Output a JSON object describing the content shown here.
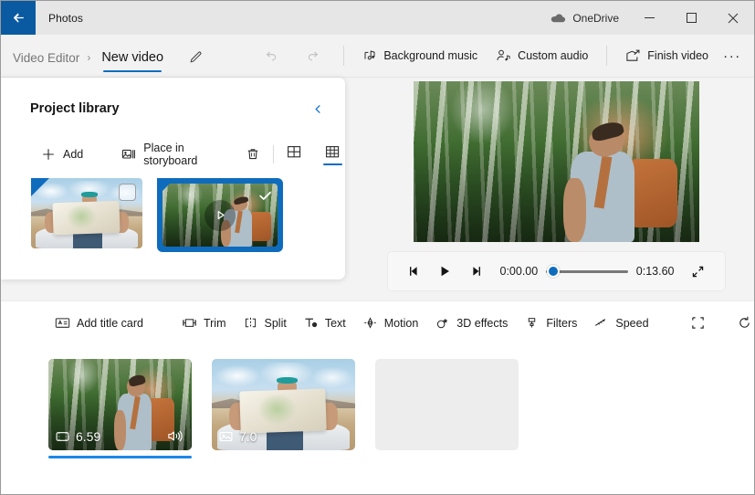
{
  "window": {
    "app_title": "Photos",
    "back_icon": "back-arrow-icon",
    "onedrive_label": "OneDrive",
    "onedrive_icon": "cloud-icon",
    "minimize_icon": "minimize-icon",
    "maximize_icon": "maximize-icon",
    "close_icon": "close-icon"
  },
  "commandbar": {
    "breadcrumb_parent": "Video Editor",
    "breadcrumb_separator": "›",
    "breadcrumb_current": "New video",
    "rename_icon": "pencil-icon",
    "undo_icon": "undo-icon",
    "redo_icon": "redo-icon",
    "items": [
      {
        "label": "Background music",
        "icon": "music-note-icon"
      },
      {
        "label": "Custom audio",
        "icon": "person-audio-icon"
      },
      {
        "label": "Finish video",
        "icon": "export-icon"
      }
    ],
    "overflow_label": "···"
  },
  "library": {
    "title": "Project library",
    "collapse_icon": "chevron-left-icon",
    "toolbar": {
      "add_label": "Add",
      "add_icon": "plus-icon",
      "place_label": "Place in storyboard",
      "place_icon": "place-in-storyboard-icon",
      "delete_icon": "trash-icon",
      "view_large_icon": "grid-large-icon",
      "view_small_icon": "grid-small-icon",
      "active_view": "grid-small"
    },
    "items": [
      {
        "name": "map-photo-thumbnail",
        "selected": false,
        "type": "photo"
      },
      {
        "name": "forest-video-thumbnail",
        "selected": true,
        "type": "video",
        "play_icon": "play-icon",
        "check_icon": "checkmark-icon"
      }
    ]
  },
  "preview": {
    "media_name": "video-preview-frame",
    "controls": {
      "prev_frame_icon": "previous-frame-icon",
      "play_icon": "play-icon",
      "next_frame_icon": "next-frame-icon",
      "current_time": "0:00.00",
      "total_time": "0:13.60",
      "fullscreen_icon": "fullscreen-icon",
      "progress_percent": 0
    }
  },
  "edit_toolbar": {
    "items": [
      {
        "label": "Add title card",
        "icon": "title-card-icon"
      },
      {
        "label": "Trim",
        "icon": "trim-icon"
      },
      {
        "label": "Split",
        "icon": "split-icon"
      },
      {
        "label": "Text",
        "icon": "text-icon"
      },
      {
        "label": "Motion",
        "icon": "motion-icon"
      },
      {
        "label": "3D effects",
        "icon": "3d-effects-icon"
      },
      {
        "label": "Filters",
        "icon": "filters-icon"
      },
      {
        "label": "Speed",
        "icon": "speed-icon"
      }
    ],
    "icon_buttons": [
      {
        "name": "crop-button",
        "icon": "crop-icon"
      },
      {
        "name": "rotate-button",
        "icon": "rotate-icon"
      },
      {
        "name": "delete-button",
        "icon": "trash-icon"
      }
    ],
    "overflow_label": "···"
  },
  "storyboard": {
    "clips": [
      {
        "name": "storyboard-clip-1",
        "type": "video",
        "duration": "6.59",
        "type_icon": "film-icon",
        "audio_icon": "volume-icon",
        "selected": true
      },
      {
        "name": "storyboard-clip-2",
        "type": "photo",
        "duration": "7.0",
        "type_icon": "image-icon",
        "selected": false
      },
      {
        "name": "storyboard-clip-empty",
        "type": "empty",
        "duration": "",
        "selected": false
      }
    ]
  },
  "colors": {
    "accent": "#0f6cbd",
    "selection_underline": "#1c87e8",
    "titlebar_bg": "#e6e6e6",
    "commandbar_bg": "#f2f2f2",
    "workspace_bg": "#f3f3f3",
    "back_button_bg": "#0a5aa2"
  }
}
